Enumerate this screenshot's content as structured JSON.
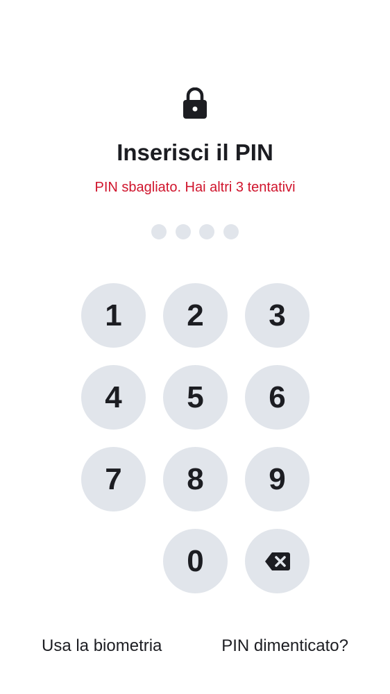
{
  "header": {
    "icon": "lock-icon",
    "title": "Inserisci il PIN",
    "error_message": "PIN sbagliato. Hai altri 3 tentativi"
  },
  "pin": {
    "length": 4,
    "entered": 0
  },
  "keypad": {
    "keys": [
      "1",
      "2",
      "3",
      "4",
      "5",
      "6",
      "7",
      "8",
      "9",
      "0"
    ],
    "backspace_icon": "backspace-icon"
  },
  "footer": {
    "biometric_label": "Usa la biometria",
    "forgot_pin_label": "PIN dimenticato?"
  },
  "colors": {
    "text": "#1c1d22",
    "error": "#d0142c",
    "key_background": "#e1e5eb",
    "background": "#ffffff"
  }
}
